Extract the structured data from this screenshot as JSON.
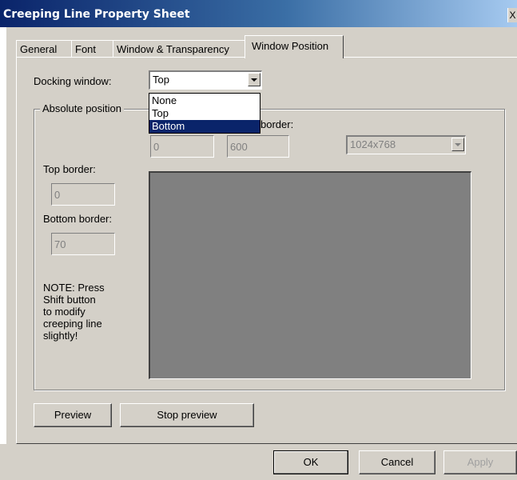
{
  "window": {
    "title": "Creeping Line Property Sheet",
    "close_glyph": "X"
  },
  "tabs": [
    {
      "label": "General",
      "active": false
    },
    {
      "label": "Font",
      "active": false
    },
    {
      "label": "Window & Transparency",
      "active": false
    },
    {
      "label": "Window Position",
      "active": true
    }
  ],
  "docking": {
    "label": "Docking window:",
    "value": "Top",
    "options": [
      "None",
      "Top",
      "Bottom"
    ],
    "highlighted_option": "Bottom"
  },
  "absolute_position": {
    "group_title": "Absolute position",
    "partial_label": "border:",
    "left_value": "0",
    "right_value": "600",
    "resolution": "1024x768",
    "top_border_label": "Top border:",
    "top_border_value": "0",
    "bottom_border_label": "Bottom border:",
    "bottom_border_value": "70",
    "note": "NOTE: Press\nShift button\nto modify\ncreeping line\nslightly!"
  },
  "preview_buttons": {
    "preview": "Preview",
    "stop_preview": "Stop preview"
  },
  "dialog_buttons": {
    "ok": "OK",
    "cancel": "Cancel",
    "apply": "Apply"
  },
  "colors": {
    "title_bar": "#0a246a",
    "dialog_face": "#d4d0c8",
    "preview_area": "#808080",
    "selection": "#0a246a"
  }
}
